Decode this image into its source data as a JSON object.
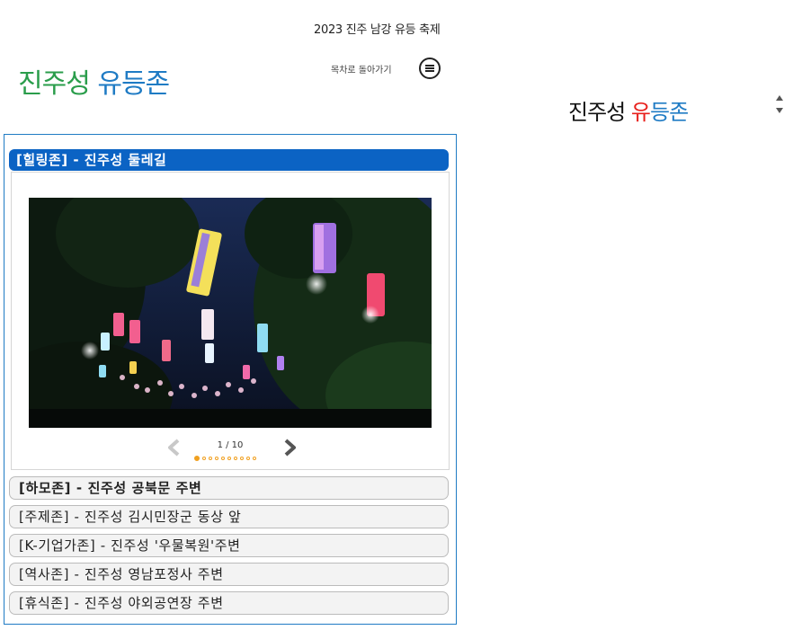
{
  "header": {
    "festival_title": "2023 진주 남강 유등 축제",
    "page_title_part1": "진주성",
    "page_title_part2": "유등존",
    "back_link": "목차로 돌아가기",
    "menu_icon": "menu-list-icon"
  },
  "side_select": {
    "part1": "진주성",
    "part2": "유",
    "part3": "등존",
    "icon": "sort-updown-icon"
  },
  "active_zone": {
    "label": "[힐링존] - 진주성 둘레길"
  },
  "gallery": {
    "counter": "1 / 10",
    "current_index": 1,
    "total": 10,
    "prev_icon": "chevron-left-icon",
    "next_icon": "chevron-right-icon"
  },
  "zones": [
    {
      "label": "[하모존] - 진주성 공북문 주변",
      "bold": true
    },
    {
      "label": "[주제존] - 진주성 김시민장군 동상 앞",
      "bold": false
    },
    {
      "label": "[K-기업가존] - 진주성 '우물복원'주변",
      "bold": false
    },
    {
      "label": "[역사존] - 진주성 영남포정사 주변",
      "bold": false
    },
    {
      "label": "[휴식존] - 진주성 야외공연장 주변",
      "bold": false
    }
  ],
  "colors": {
    "title_green": "#2a9d4b",
    "title_blue": "#1f7bc4",
    "active_header_bg": "#0b63c4",
    "accent_red": "#e8201c",
    "dot_orange": "#f0a020"
  }
}
